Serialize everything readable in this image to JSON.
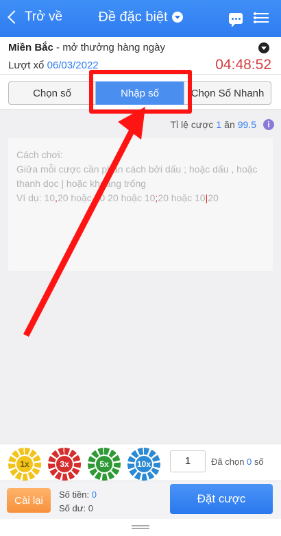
{
  "header": {
    "back_label": "Trở về",
    "title": "Đề đặc biệt"
  },
  "info": {
    "region": "Miền Bắc",
    "region_desc": " - mở thưởng hàng ngày",
    "draw_label": "Lượt xổ ",
    "draw_date": "06/03/2022",
    "countdown": "04:48:52"
  },
  "tabs": [
    {
      "label": "Chọn số"
    },
    {
      "label": "Nhập số"
    },
    {
      "label": "Chọn Số Nhanh"
    }
  ],
  "rate": {
    "prefix": "Tỉ lệ cược",
    "amount": "1",
    "mid": "ăn",
    "payout": "99.5",
    "help": "i"
  },
  "instructions": {
    "title": "Cách chơi:",
    "line1": "Giữa mỗi cược cần phân cách bởi dấu ; hoặc dấu , hoặc thanh dọc | hoặc khoảng trống",
    "example_prefix": "Ví dụ: 10",
    "sep1": ",",
    "ex_a": "20 hoặc 10",
    "sep2": " ",
    "ex_b": "20 hoặc 10",
    "sep3": ";",
    "ex_c": "20 hoặc 10",
    "sep4": "|",
    "ex_d": "20"
  },
  "chips": [
    {
      "label": "1x",
      "color": "#f2c31b"
    },
    {
      "label": "3x",
      "color": "#d62d2d"
    },
    {
      "label": "5x",
      "color": "#2f9a35"
    },
    {
      "label": "10x",
      "color": "#2c8ad4"
    }
  ],
  "quantity": "1",
  "chosen": {
    "prefix": "Đã chọn",
    "count": "0",
    "suffix": "số"
  },
  "footer": {
    "reset_label": "Cài lại",
    "amount_label": "Số tiền:",
    "amount_value": "0",
    "balance_label": "Số dư:",
    "balance_value": "0",
    "bet_label": "Đặt cược"
  },
  "colors": {
    "header": "#2f7cf0",
    "active_tab": "#4a8ef0",
    "countdown": "#d43c3c",
    "highlight": "#ff1414",
    "reset": "#f7913c"
  }
}
